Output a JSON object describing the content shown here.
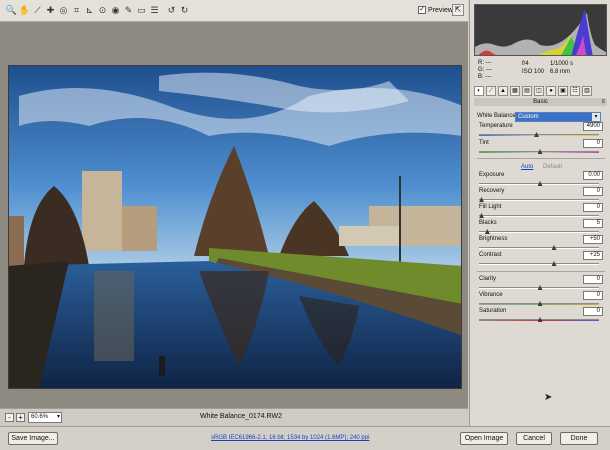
{
  "toolbar": {
    "tools": [
      {
        "icon": "zoom-icon",
        "glyph": "🔍"
      },
      {
        "icon": "hand-icon",
        "glyph": "✋"
      },
      {
        "icon": "white-balance-eyedropper-icon",
        "glyph": "⟋"
      },
      {
        "icon": "color-sampler-icon",
        "glyph": "✚"
      },
      {
        "icon": "target-adjust-icon",
        "glyph": "◎"
      },
      {
        "icon": "crop-icon",
        "glyph": "⌗"
      },
      {
        "icon": "straighten-icon",
        "glyph": "⊾"
      },
      {
        "icon": "spot-removal-icon",
        "glyph": "⊙"
      },
      {
        "icon": "red-eye-icon",
        "glyph": "◉"
      },
      {
        "icon": "adjustment-brush-icon",
        "glyph": "✎"
      },
      {
        "icon": "graduated-filter-icon",
        "glyph": "▭"
      },
      {
        "icon": "preferences-icon",
        "glyph": "☰"
      },
      {
        "icon": "rotate-left-icon",
        "glyph": "↺"
      },
      {
        "icon": "rotate-right-icon",
        "glyph": "↻"
      }
    ],
    "preview_label": "Preview",
    "preview_checked": "✓",
    "fullscreen_glyph": "⇱"
  },
  "canvas_footer": {
    "zoom_out": "-",
    "zoom_in": "+",
    "zoom_value": "60.6%",
    "zoom_arrow": "▾",
    "filename": "White Balance_0174.RW2"
  },
  "panel": {
    "rgb": {
      "r": "R:   ---",
      "g": "G:   ---",
      "b": "B:   ---"
    },
    "camera": {
      "aperture": "f/4",
      "shutter": "1/1000 s",
      "iso": "ISO 100",
      "focal": "6.8 mm"
    },
    "tabs": [
      {
        "icon": "basic-tab-icon",
        "glyph": "◐"
      },
      {
        "icon": "tone-curve-tab-icon",
        "glyph": "⟋"
      },
      {
        "icon": "detail-tab-icon",
        "glyph": "▲"
      },
      {
        "icon": "hsl-tab-icon",
        "glyph": "▦"
      },
      {
        "icon": "split-toning-tab-icon",
        "glyph": "▤"
      },
      {
        "icon": "lens-tab-icon",
        "glyph": "◫"
      },
      {
        "icon": "effects-tab-icon",
        "glyph": "●"
      },
      {
        "icon": "camera-calibration-tab-icon",
        "glyph": "▣"
      },
      {
        "icon": "presets-tab-icon",
        "glyph": "☷"
      },
      {
        "icon": "snapshots-tab-icon",
        "glyph": "▥"
      }
    ],
    "section_title": "Basic",
    "section_menu": "≡",
    "white_balance": {
      "label": "White Balance:",
      "value": "Custom",
      "arrow": "▾"
    },
    "auto_label": "Auto",
    "default_label": "Default",
    "sliders": {
      "temperature": {
        "label": "Temperature",
        "value": "4900",
        "level": 0.47
      },
      "tint": {
        "label": "Tint",
        "value": "0",
        "level": 0.5
      },
      "exposure": {
        "label": "Exposure",
        "value": "0.00",
        "level": 0.5
      },
      "recovery": {
        "label": "Recovery",
        "value": "0",
        "level": 0.0
      },
      "fill_light": {
        "label": "Fill Light",
        "value": "0",
        "level": 0.0
      },
      "blacks": {
        "label": "Blacks",
        "value": "5",
        "level": 0.05
      },
      "brightness": {
        "label": "Brightness",
        "value": "+50",
        "level": 0.62
      },
      "contrast": {
        "label": "Contrast",
        "value": "+25",
        "level": 0.62
      },
      "clarity": {
        "label": "Clarity",
        "value": "0",
        "level": 0.5
      },
      "vibrance": {
        "label": "Vibrance",
        "value": "0",
        "level": 0.5
      },
      "saturation": {
        "label": "Saturation",
        "value": "0",
        "level": 0.5
      }
    }
  },
  "bottom": {
    "save_image": "Save Image...",
    "workflow_link": "sRGB IEC61966-2.1; 16 bit; 1534 by 1024 (1.6MP); 240 ppi",
    "open_image": "Open Image",
    "cancel": "Cancel",
    "done": "Done"
  },
  "colors": {
    "accent": "#3b71c7",
    "link": "#1a3fbf"
  }
}
